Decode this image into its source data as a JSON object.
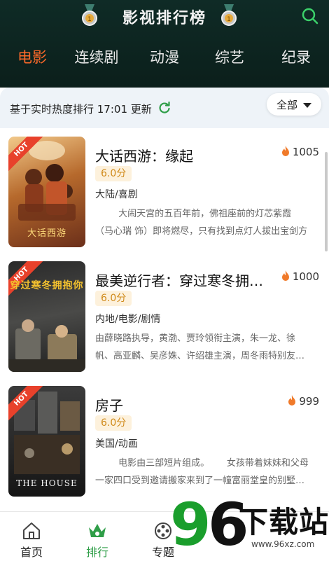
{
  "header": {
    "title": "影视排行榜",
    "tabs": [
      "电影",
      "连续剧",
      "动漫",
      "综艺",
      "纪录"
    ],
    "active_tab": 0
  },
  "status": {
    "text": "基于实时热度排行 17:01 更新",
    "filter_label": "全部"
  },
  "items": [
    {
      "name": "大话西游：缘起",
      "heat": "1005",
      "score": "6.0分",
      "genre": "大陆/喜剧",
      "desc": "        大闹天宫的五百年前，佛祖座前的灯芯紫霞（马心瑞 饰）即将燃尽，只有找到点灯人拔出宝剑方能…",
      "ribbon": "HOT",
      "poster_caption": "大话西游"
    },
    {
      "name": "最美逆行者：穿过寒冬拥抱你",
      "heat": "1000",
      "score": "6.0分",
      "genre": "内地/电影/剧情",
      "desc": "由薛晓路执导，黄渤、贾玲领衔主演，朱一龙、徐帆、高亚麟、吴彦姝、许绍雄主演，周冬雨特别友…",
      "ribbon": "HOT",
      "poster_caption": "穿过寒冬拥抱你"
    },
    {
      "name": "房子",
      "heat": "999",
      "score": "6.0分",
      "genre": "美国/动画",
      "desc": "        电影由三部短片组成。      女孩带着妹妹和父母一家四口受到邀请搬家来到了一幢富丽堂皇的别墅…",
      "ribbon": "HOT",
      "poster_caption": "THE HOUSE"
    }
  ],
  "bottom_nav": [
    {
      "label": "首页"
    },
    {
      "label": "排行"
    },
    {
      "label": "专题"
    }
  ],
  "watermark": {
    "digits": "96",
    "text": "下载站",
    "url": "www.96xz.com"
  },
  "colors": {
    "header_bg": "#0f2b26",
    "active_tab": "#ff6a2a",
    "accent_green": "#2f9e48",
    "hot_ribbon": "#e8412b",
    "flame": "#f07a2a",
    "score_bg": "#fdf1dc",
    "score_text": "#d08a1a"
  }
}
